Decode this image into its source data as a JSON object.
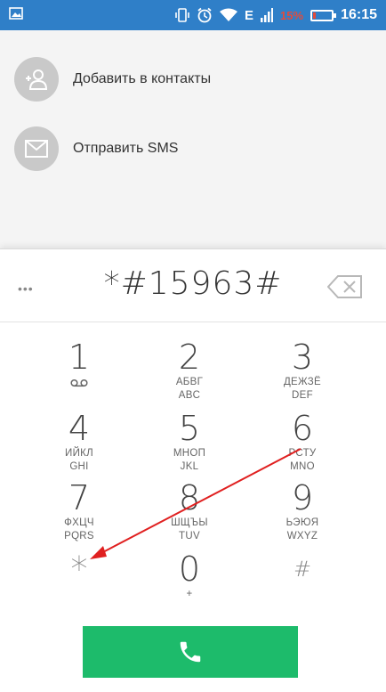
{
  "status_bar": {
    "battery_percent": "15%",
    "time": "16:15",
    "network": "E",
    "icons": [
      "image-icon",
      "vibrate-icon",
      "alarm-icon",
      "wifi-icon",
      "signal-icon",
      "battery-icon"
    ],
    "battery_level": 0.15,
    "battery_color": "#e24b3b"
  },
  "actions": [
    {
      "label": "Добавить в контакты",
      "icon": "add-contact-icon"
    },
    {
      "label": "Отправить SMS",
      "icon": "sms-icon"
    }
  ],
  "dialer": {
    "number": "*#15963#",
    "keys": [
      {
        "num": "1",
        "sub1": "",
        "sub2": "",
        "voicemail": true
      },
      {
        "num": "2",
        "sub1": "АБВГ",
        "sub2": "ABC"
      },
      {
        "num": "3",
        "sub1": "ДЕЖЗЁ",
        "sub2": "DEF"
      },
      {
        "num": "4",
        "sub1": "ИЙКЛ",
        "sub2": "GHI"
      },
      {
        "num": "5",
        "sub1": "МНОП",
        "sub2": "JKL"
      },
      {
        "num": "6",
        "sub1": "РСТУ",
        "sub2": "MNO"
      },
      {
        "num": "7",
        "sub1": "ФХЦЧ",
        "sub2": "PQRS"
      },
      {
        "num": "8",
        "sub1": "ШЩЪЫ",
        "sub2": "TUV"
      },
      {
        "num": "9",
        "sub1": "ЬЭЮЯ",
        "sub2": "WXYZ"
      },
      {
        "num": "*",
        "sub1": "",
        "sub2": ""
      },
      {
        "num": "0",
        "sub1": "+",
        "sub2": ""
      },
      {
        "num": "#",
        "sub1": "",
        "sub2": ""
      }
    ]
  },
  "colors": {
    "status_bar": "#2f7fc8",
    "call_button": "#1dbb6b",
    "annotation_arrow": "#e02020"
  }
}
